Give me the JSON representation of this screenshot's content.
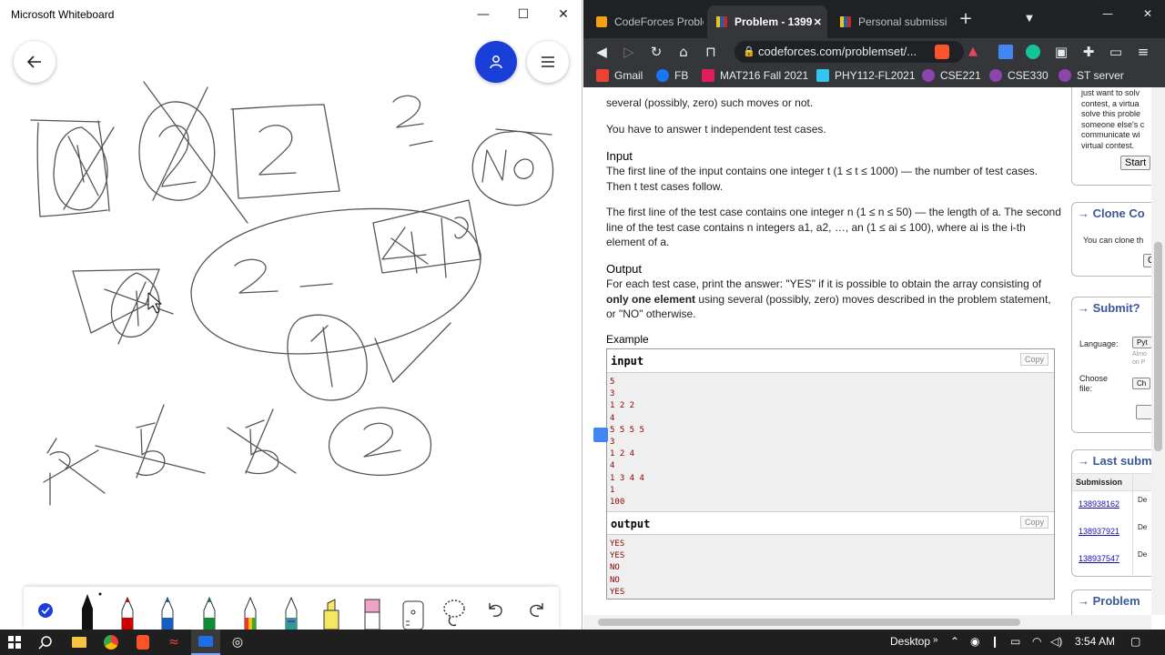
{
  "whiteboard": {
    "title": "Microsoft Whiteboard",
    "controls": {
      "minimize": "—",
      "maximize": "☐",
      "close": "✕"
    }
  },
  "browser": {
    "tabs": [
      {
        "label": "CodeForces Proble",
        "active": false
      },
      {
        "label": "Problem - 1399",
        "active": true
      },
      {
        "label": "Personal submissio",
        "active": false
      }
    ],
    "new_tab": "+",
    "url": "codeforces.com/problemset/...",
    "bookmarks": [
      "Gmail",
      "FB",
      "MAT216 Fall 2021",
      "PHY112-FL2021",
      "CSE221",
      "CSE330",
      "ST server"
    ]
  },
  "problem": {
    "cut_line": "several (possibly, zero) such moves or not.",
    "tests_line": "You have to answer t independent test cases.",
    "input_heading": "Input",
    "input_p1": "The first line of the input contains one integer t (1 ≤ t ≤ 1000) — the number of test cases. Then t test cases follow.",
    "input_p2": "The first line of the test case contains one integer n (1 ≤ n ≤ 50) — the length of a. The second line of the test case contains n integers a1, a2, …, an (1 ≤ ai ≤ 100), where ai is the i-th element of a.",
    "output_heading": "Output",
    "output_p_start": "For each test case, print the answer: \"YES\" if it is possible to obtain the array consisting of ",
    "output_p_bold": "only one element",
    "output_p_end": " using several (possibly, zero) moves described in the problem statement, or \"NO\" otherwise.",
    "example_heading": "Example",
    "input_label": "input",
    "output_label": "output",
    "copy_label": "Copy",
    "sample_input": "5\n3\n1 2 2\n4\n5 5 5 5\n3\n1 2 4\n4\n1 3 4 4\n1\n100",
    "sample_output": "YES\nYES\nNO\nNO\nYES"
  },
  "sidebar": {
    "virtual_text": "just want to solv\ncontest, a virtua\nsolve this proble\nsomeone else's c\ncommunicate wi\nvirtual contest.",
    "start_label": "Start",
    "clone_title": "→ Clone Co",
    "clone_text": "You can clone th",
    "clone_btn": "C",
    "submit_title": "→ Submit?",
    "language_label": "Language:",
    "language_value": "Pyt",
    "language_hint": "Almo\non P",
    "choose_label": "Choose\nfile:",
    "choose_btn": "Ch",
    "last_title": "→ Last subm",
    "submission_header": "Submission",
    "submissions": [
      "138938162",
      "138937921",
      "138937547"
    ],
    "submission_cut": "De",
    "problem_title": "→ Problem"
  },
  "taskbar": {
    "desktop_label": "Desktop",
    "time": "3:54 AM"
  },
  "colors": {
    "whiteboard_accent": "#1a3fd8",
    "ink": "#555555",
    "browser_dark": "#202124",
    "cf_blue": "#3b5998"
  }
}
